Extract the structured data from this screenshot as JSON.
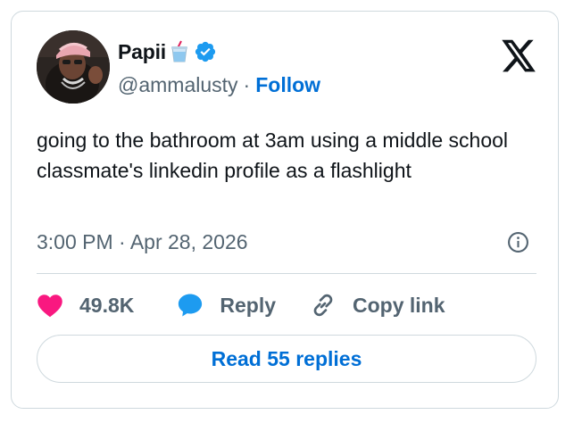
{
  "author": {
    "display_name": "Papii",
    "handle": "@ammalusty",
    "separator": "·",
    "follow_label": "Follow",
    "verified_color": "#1d9bf0",
    "emoji": "cup-with-straw"
  },
  "tweet": {
    "text": "going to the bathroom at 3am using a middle school classmate's linkedin profile as a flashlight",
    "timestamp": "3:00 PM · Apr 28, 2026"
  },
  "actions": {
    "like_count": "49.8K",
    "reply_label": "Reply",
    "copy_label": "Copy link",
    "read_replies_label": "Read 55 replies"
  },
  "colors": {
    "text": "#0f1419",
    "muted": "#536471",
    "link": "#006fd6",
    "heart": "#f91880",
    "border": "#cfd9de"
  }
}
